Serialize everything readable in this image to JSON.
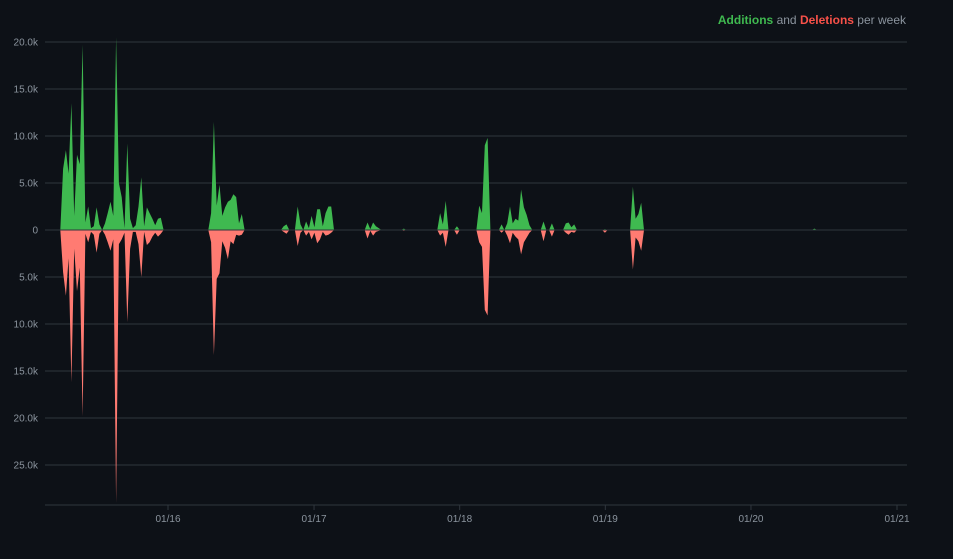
{
  "legend": {
    "additions_label": "Additions",
    "and_label": "and",
    "deletions_label": "Deletions",
    "per_week_label": "per week"
  },
  "colors": {
    "background": "#0d1117",
    "additions": "#3fb950",
    "deletions": "#ff7b72",
    "grid": "#30363d",
    "text": "#8b949e"
  },
  "chart_data": {
    "type": "area",
    "title": "Additions and Deletions per week",
    "xlabel": "",
    "ylabel": "",
    "grid": true,
    "legend_position": "top-right",
    "xlim": [
      "2015-02-09",
      "2021-01-01"
    ],
    "ylim": [
      -29000,
      20000
    ],
    "y_ticks": [
      {
        "value": 20000,
        "label": "20.0k"
      },
      {
        "value": 15000,
        "label": "15.0k"
      },
      {
        "value": 10000,
        "label": "10.0k"
      },
      {
        "value": 5000,
        "label": "5.0k"
      },
      {
        "value": 0,
        "label": "0"
      },
      {
        "value": -5000,
        "label": "5.0k"
      },
      {
        "value": -10000,
        "label": "10.0k"
      },
      {
        "value": -15000,
        "label": "15.0k"
      },
      {
        "value": -20000,
        "label": "20.0k"
      },
      {
        "value": -25000,
        "label": "25.0k"
      }
    ],
    "x_ticks": [
      {
        "value": "2016-01-01",
        "label": "01/16"
      },
      {
        "value": "2017-01-01",
        "label": "01/17"
      },
      {
        "value": "2018-01-01",
        "label": "01/18"
      },
      {
        "value": "2019-01-01",
        "label": "01/19"
      },
      {
        "value": "2020-01-01",
        "label": "01/20"
      },
      {
        "value": "2021-01-01",
        "label": "01/21"
      }
    ],
    "series": [
      {
        "name": "Additions",
        "points": [
          [
            "2015-04-06",
            0
          ],
          [
            "2015-04-13",
            6500
          ],
          [
            "2015-04-20",
            8500
          ],
          [
            "2015-04-27",
            6000
          ],
          [
            "2015-05-04",
            13500
          ],
          [
            "2015-05-11",
            1500
          ],
          [
            "2015-05-18",
            8000
          ],
          [
            "2015-05-25",
            7000
          ],
          [
            "2015-06-01",
            19700
          ],
          [
            "2015-06-08",
            800
          ],
          [
            "2015-06-15",
            2500
          ],
          [
            "2015-06-22",
            200
          ],
          [
            "2015-06-29",
            400
          ],
          [
            "2015-07-06",
            2400
          ],
          [
            "2015-07-13",
            600
          ],
          [
            "2015-07-20",
            0
          ],
          [
            "2015-07-27",
            700
          ],
          [
            "2015-08-03",
            1800
          ],
          [
            "2015-08-10",
            3000
          ],
          [
            "2015-08-17",
            1500
          ],
          [
            "2015-08-24",
            20500
          ],
          [
            "2015-08-31",
            5000
          ],
          [
            "2015-09-07",
            3500
          ],
          [
            "2015-09-14",
            200
          ],
          [
            "2015-09-21",
            9200
          ],
          [
            "2015-09-28",
            1200
          ],
          [
            "2015-10-05",
            200
          ],
          [
            "2015-10-12",
            500
          ],
          [
            "2015-10-19",
            2500
          ],
          [
            "2015-10-26",
            5600
          ],
          [
            "2015-11-02",
            400
          ],
          [
            "2015-11-09",
            2400
          ],
          [
            "2015-11-16",
            1800
          ],
          [
            "2015-11-23",
            1200
          ],
          [
            "2015-11-30",
            500
          ],
          [
            "2015-12-07",
            1200
          ],
          [
            "2015-12-14",
            1300
          ],
          [
            "2015-12-21",
            0
          ],
          [
            "2016-04-11",
            0
          ],
          [
            "2016-04-18",
            1800
          ],
          [
            "2016-04-25",
            11500
          ],
          [
            "2016-05-02",
            2600
          ],
          [
            "2016-05-09",
            4800
          ],
          [
            "2016-05-16",
            1500
          ],
          [
            "2016-05-23",
            2400
          ],
          [
            "2016-05-30",
            3000
          ],
          [
            "2016-06-06",
            3200
          ],
          [
            "2016-06-13",
            3800
          ],
          [
            "2016-06-20",
            3500
          ],
          [
            "2016-06-27",
            700
          ],
          [
            "2016-07-04",
            1700
          ],
          [
            "2016-07-11",
            0
          ],
          [
            "2016-10-10",
            0
          ],
          [
            "2016-10-17",
            400
          ],
          [
            "2016-10-24",
            600
          ],
          [
            "2016-10-31",
            0
          ],
          [
            "2016-11-14",
            0
          ],
          [
            "2016-11-21",
            2500
          ],
          [
            "2016-11-28",
            600
          ],
          [
            "2016-12-05",
            0
          ],
          [
            "2016-12-12",
            900
          ],
          [
            "2016-12-19",
            200
          ],
          [
            "2016-12-26",
            1500
          ],
          [
            "2017-01-02",
            300
          ],
          [
            "2017-01-09",
            2200
          ],
          [
            "2017-01-16",
            2200
          ],
          [
            "2017-01-23",
            400
          ],
          [
            "2017-01-30",
            1800
          ],
          [
            "2017-02-06",
            2500
          ],
          [
            "2017-02-13",
            2500
          ],
          [
            "2017-02-20",
            0
          ],
          [
            "2017-05-08",
            0
          ],
          [
            "2017-05-15",
            800
          ],
          [
            "2017-05-22",
            100
          ],
          [
            "2017-05-29",
            800
          ],
          [
            "2017-06-05",
            400
          ],
          [
            "2017-06-12",
            200
          ],
          [
            "2017-06-19",
            0
          ],
          [
            "2017-08-07",
            0
          ],
          [
            "2017-08-14",
            150
          ],
          [
            "2017-08-21",
            0
          ],
          [
            "2017-11-06",
            0
          ],
          [
            "2017-11-13",
            1800
          ],
          [
            "2017-11-20",
            600
          ],
          [
            "2017-11-27",
            3100
          ],
          [
            "2017-12-04",
            0
          ],
          [
            "2017-12-18",
            0
          ],
          [
            "2017-12-25",
            400
          ],
          [
            "2018-01-01",
            0
          ],
          [
            "2018-02-12",
            0
          ],
          [
            "2018-02-19",
            2600
          ],
          [
            "2018-02-26",
            1800
          ],
          [
            "2018-03-05",
            9000
          ],
          [
            "2018-03-12",
            9800
          ],
          [
            "2018-03-19",
            0
          ],
          [
            "2018-04-09",
            0
          ],
          [
            "2018-04-16",
            600
          ],
          [
            "2018-04-23",
            0
          ],
          [
            "2018-04-30",
            700
          ],
          [
            "2018-05-07",
            2500
          ],
          [
            "2018-05-14",
            700
          ],
          [
            "2018-05-21",
            1200
          ],
          [
            "2018-05-28",
            1000
          ],
          [
            "2018-06-04",
            4300
          ],
          [
            "2018-06-11",
            2400
          ],
          [
            "2018-06-18",
            1600
          ],
          [
            "2018-06-25",
            500
          ],
          [
            "2018-07-02",
            0
          ],
          [
            "2018-07-23",
            0
          ],
          [
            "2018-07-30",
            900
          ],
          [
            "2018-08-06",
            0
          ],
          [
            "2018-08-13",
            0
          ],
          [
            "2018-08-20",
            700
          ],
          [
            "2018-08-27",
            0
          ],
          [
            "2018-09-17",
            0
          ],
          [
            "2018-09-24",
            700
          ],
          [
            "2018-10-01",
            800
          ],
          [
            "2018-10-08",
            300
          ],
          [
            "2018-10-15",
            600
          ],
          [
            "2018-10-22",
            0
          ],
          [
            "2018-12-24",
            0
          ],
          [
            "2018-12-31",
            100
          ],
          [
            "2019-01-07",
            0
          ],
          [
            "2019-03-04",
            0
          ],
          [
            "2019-03-11",
            4600
          ],
          [
            "2019-03-18",
            1200
          ],
          [
            "2019-03-25",
            1700
          ],
          [
            "2019-04-01",
            2900
          ],
          [
            "2019-04-08",
            0
          ],
          [
            "2020-06-01",
            0
          ],
          [
            "2020-06-08",
            150
          ],
          [
            "2020-06-15",
            0
          ]
        ]
      },
      {
        "name": "Deletions",
        "points": [
          [
            "2015-04-06",
            0
          ],
          [
            "2015-04-13",
            -4500
          ],
          [
            "2015-04-20",
            -7000
          ],
          [
            "2015-04-27",
            -3000
          ],
          [
            "2015-05-04",
            -16200
          ],
          [
            "2015-05-11",
            -2000
          ],
          [
            "2015-05-18",
            -6500
          ],
          [
            "2015-05-25",
            -4000
          ],
          [
            "2015-06-01",
            -19800
          ],
          [
            "2015-06-08",
            -400
          ],
          [
            "2015-06-15",
            -1300
          ],
          [
            "2015-06-22",
            -200
          ],
          [
            "2015-06-29",
            -500
          ],
          [
            "2015-07-06",
            -2400
          ],
          [
            "2015-07-13",
            -400
          ],
          [
            "2015-07-20",
            0
          ],
          [
            "2015-07-27",
            -500
          ],
          [
            "2015-08-03",
            -1300
          ],
          [
            "2015-08-10",
            -2200
          ],
          [
            "2015-08-17",
            -1000
          ],
          [
            "2015-08-24",
            -29000
          ],
          [
            "2015-08-31",
            -1500
          ],
          [
            "2015-09-07",
            -1000
          ],
          [
            "2015-09-14",
            -300
          ],
          [
            "2015-09-21",
            -9800
          ],
          [
            "2015-09-28",
            -2000
          ],
          [
            "2015-10-05",
            -200
          ],
          [
            "2015-10-12",
            -200
          ],
          [
            "2015-10-19",
            -1500
          ],
          [
            "2015-10-26",
            -5000
          ],
          [
            "2015-11-02",
            -200
          ],
          [
            "2015-11-09",
            -1600
          ],
          [
            "2015-11-16",
            -1300
          ],
          [
            "2015-11-23",
            -700
          ],
          [
            "2015-11-30",
            -300
          ],
          [
            "2015-12-07",
            -700
          ],
          [
            "2015-12-14",
            -400
          ],
          [
            "2015-12-21",
            0
          ],
          [
            "2016-04-11",
            0
          ],
          [
            "2016-04-18",
            -1300
          ],
          [
            "2016-04-25",
            -13300
          ],
          [
            "2016-05-02",
            -5200
          ],
          [
            "2016-05-09",
            -4600
          ],
          [
            "2016-05-16",
            -1200
          ],
          [
            "2016-05-23",
            -1900
          ],
          [
            "2016-05-30",
            -3100
          ],
          [
            "2016-06-06",
            -1200
          ],
          [
            "2016-06-13",
            -1500
          ],
          [
            "2016-06-20",
            -500
          ],
          [
            "2016-06-27",
            -600
          ],
          [
            "2016-07-04",
            -500
          ],
          [
            "2016-07-11",
            0
          ],
          [
            "2016-10-10",
            0
          ],
          [
            "2016-10-17",
            -200
          ],
          [
            "2016-10-24",
            -400
          ],
          [
            "2016-10-31",
            0
          ],
          [
            "2016-11-14",
            0
          ],
          [
            "2016-11-21",
            -1700
          ],
          [
            "2016-11-28",
            -300
          ],
          [
            "2016-12-05",
            0
          ],
          [
            "2016-12-12",
            -600
          ],
          [
            "2016-12-19",
            -200
          ],
          [
            "2016-12-26",
            -1000
          ],
          [
            "2017-01-02",
            -300
          ],
          [
            "2017-01-09",
            -1400
          ],
          [
            "2017-01-16",
            -1000
          ],
          [
            "2017-01-23",
            -200
          ],
          [
            "2017-01-30",
            -600
          ],
          [
            "2017-02-06",
            -500
          ],
          [
            "2017-02-13",
            -300
          ],
          [
            "2017-02-20",
            0
          ],
          [
            "2017-05-08",
            0
          ],
          [
            "2017-05-15",
            -900
          ],
          [
            "2017-05-22",
            -100
          ],
          [
            "2017-05-29",
            -600
          ],
          [
            "2017-06-05",
            -200
          ],
          [
            "2017-06-12",
            -100
          ],
          [
            "2017-06-19",
            0
          ],
          [
            "2017-08-07",
            0
          ],
          [
            "2017-08-14",
            -100
          ],
          [
            "2017-08-21",
            0
          ],
          [
            "2017-11-06",
            0
          ],
          [
            "2017-11-13",
            -600
          ],
          [
            "2017-11-20",
            -300
          ],
          [
            "2017-11-27",
            -1800
          ],
          [
            "2017-12-04",
            0
          ],
          [
            "2017-12-18",
            0
          ],
          [
            "2017-12-25",
            -500
          ],
          [
            "2018-01-01",
            0
          ],
          [
            "2018-02-12",
            0
          ],
          [
            "2018-02-19",
            -1300
          ],
          [
            "2018-02-26",
            -1800
          ],
          [
            "2018-03-05",
            -8500
          ],
          [
            "2018-03-12",
            -9100
          ],
          [
            "2018-03-19",
            0
          ],
          [
            "2018-04-09",
            0
          ],
          [
            "2018-04-16",
            -300
          ],
          [
            "2018-04-23",
            0
          ],
          [
            "2018-04-30",
            -600
          ],
          [
            "2018-05-07",
            -1400
          ],
          [
            "2018-05-14",
            -300
          ],
          [
            "2018-05-21",
            -700
          ],
          [
            "2018-05-28",
            -1000
          ],
          [
            "2018-06-04",
            -2600
          ],
          [
            "2018-06-11",
            -1300
          ],
          [
            "2018-06-18",
            -800
          ],
          [
            "2018-06-25",
            -300
          ],
          [
            "2018-07-02",
            0
          ],
          [
            "2018-07-23",
            0
          ],
          [
            "2018-07-30",
            -1200
          ],
          [
            "2018-08-06",
            0
          ],
          [
            "2018-08-13",
            0
          ],
          [
            "2018-08-20",
            -700
          ],
          [
            "2018-08-27",
            0
          ],
          [
            "2018-09-17",
            0
          ],
          [
            "2018-09-24",
            -300
          ],
          [
            "2018-10-01",
            -500
          ],
          [
            "2018-10-08",
            -200
          ],
          [
            "2018-10-15",
            -300
          ],
          [
            "2018-10-22",
            0
          ],
          [
            "2018-12-24",
            0
          ],
          [
            "2018-12-31",
            -300
          ],
          [
            "2019-01-07",
            0
          ],
          [
            "2019-03-04",
            0
          ],
          [
            "2019-03-11",
            -4200
          ],
          [
            "2019-03-18",
            -800
          ],
          [
            "2019-03-25",
            -1200
          ],
          [
            "2019-04-01",
            -2200
          ],
          [
            "2019-04-08",
            0
          ],
          [
            "2020-06-01",
            0
          ],
          [
            "2020-06-08",
            -50
          ],
          [
            "2020-06-15",
            0
          ]
        ]
      }
    ]
  }
}
